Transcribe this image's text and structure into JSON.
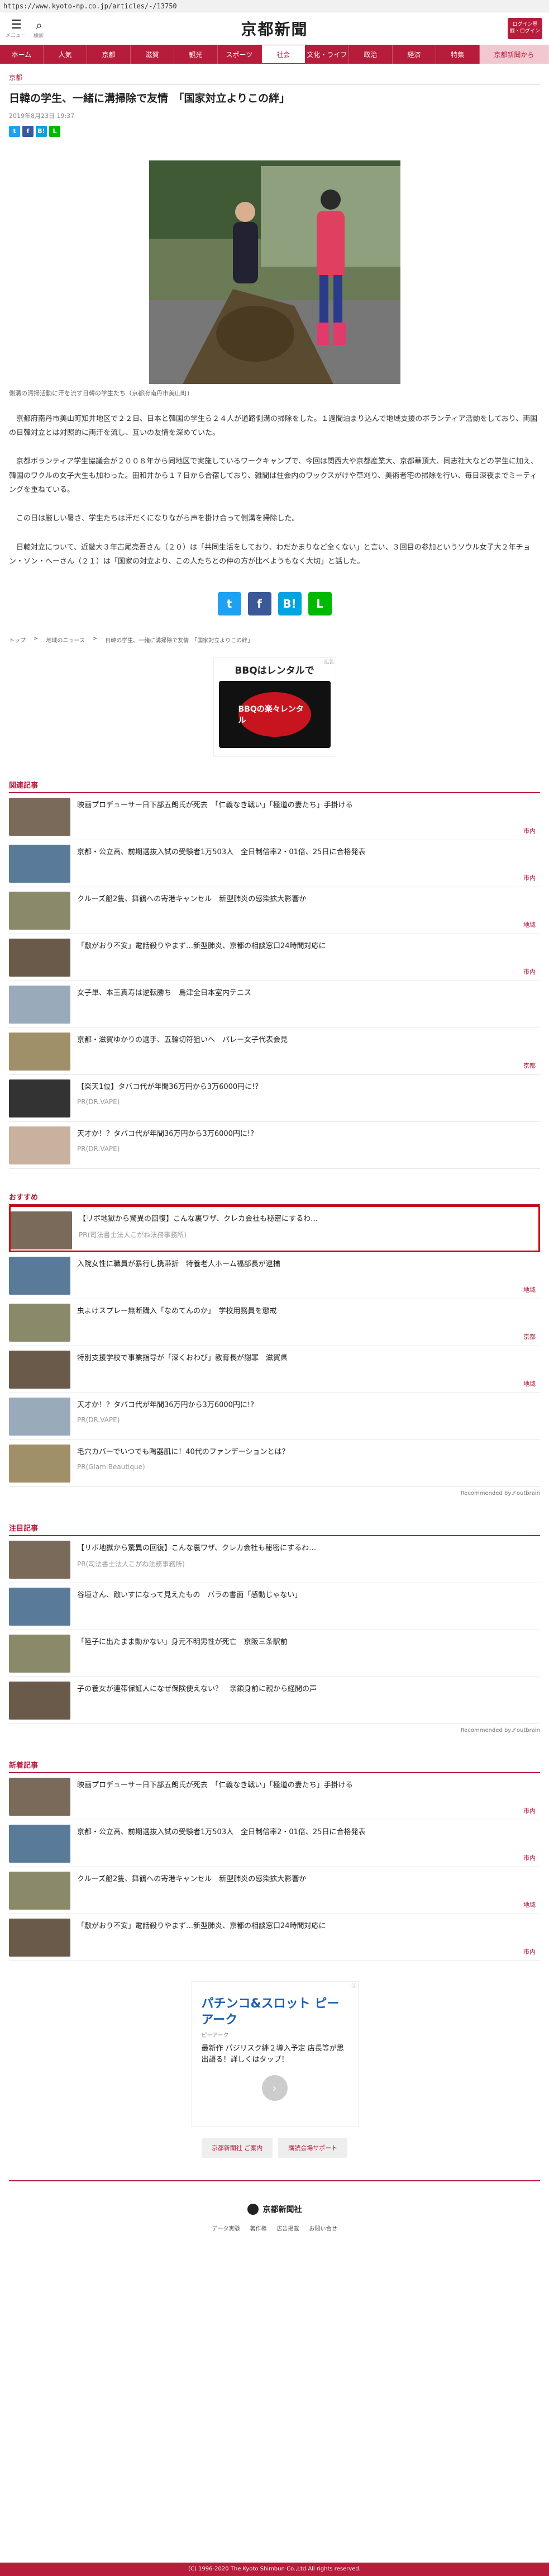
{
  "url": "https://www.kyoto-np.co.jp/articles/-/13750",
  "header": {
    "menu_label": "メニュー",
    "search_label": "検索",
    "logo": "京都新聞",
    "login": "ログイン登録・ログイン"
  },
  "nav": [
    "ホーム",
    "人気",
    "京都",
    "滋賀",
    "観光",
    "スポーツ",
    "社会",
    "文化・ライフ",
    "政治",
    "経済",
    "特集",
    "京都新聞から"
  ],
  "article": {
    "category": "京都",
    "title": "日韓の学生、一緒に溝掃除で友情　「国家対立よりこの絆」",
    "date": "2019年8月23日 19:37",
    "caption": "側溝の清掃活動に汗を流す日韓の学生たち（京都府南丹市美山町)",
    "paragraphs": [
      "　京都府南丹市美山町知井地区で２２日、日本と韓国の学生ら２４人が道路側溝の掃除をした。１週間泊まり込んで地域支援のボランティア活動をしており、両国の日韓対立とは対照的に両汗を流し、互いの友情を深めていた。",
      "　京都ボランティア学生協議会が２００８年から同地区で実施しているワークキャンプで、今回は関西大や京都産業大、京都華頂大、同志社大などの学生に加え、韓国のワクルの女子大生も加わった。田和井から１７日から合宿しており、雑間は住会内のワックスがけや草刈り、美術者宅の掃除を行い、毎日深夜までミーティングを重ねている。",
      "　この日は厳しい暑さ、学生たちは汗だくになりながら声を掛け合って側溝を掃除した。",
      "　日韓対立について、近畿大３年古尾亮吾さん（２０）は「共同生活をしており、わだかまりなど全くない」と言い、３回目の参加というソウル女子大２年チョン・ソン・ヘーさん（２１）は「国家の対立より、この人たちとの仲の方が比べようもなく大切」と話した。"
    ]
  },
  "share": {
    "twitter": "t",
    "facebook": "f",
    "hatena": "B!",
    "line": "L"
  },
  "breadcrumb": [
    "トップ",
    "地域のニュース",
    "日韓の学生、一緒に溝掃除で友情　「国家対立よりこの絆」"
  ],
  "ad1": {
    "label": "広告",
    "text": "BBQはレンタルで",
    "sub": "BBQの楽々レンタル"
  },
  "related": {
    "heading": "関連記事",
    "items": [
      {
        "title": "映画プロデューサー日下部五朗氏が死去　「仁義なき戦い」「極道の妻たち」手掛ける",
        "tag": "市内"
      },
      {
        "title": "京都・公立高、前期選抜入試の受験者1万503人　全日制倍率2・01倍、25日に合格発表",
        "tag": "市内"
      },
      {
        "title": "クルーズ船2隻、舞鶴への寄港キャンセル　新型肺炎の感染拡大影響か",
        "tag": "地域"
      },
      {
        "title": "「敷がおり不安」電話殺りやまず…新型肺炎、京都の相談窓口24時間対応に",
        "tag": "市内"
      },
      {
        "title": "女子単、本王真寿は逆転勝ち　島津全日本室内テニス",
        "tag": ""
      },
      {
        "title": "京都・滋賀ゆかりの選手、五輪切符狙いへ　パレー女子代表会見",
        "tag": "京都"
      },
      {
        "title": "【楽天1位】タバコ代が年間36万円から3万6000円に!?",
        "tag": "",
        "pr": "PR(DR.VAPE)"
      },
      {
        "title": "天才か！？タバコ代が年間36万円から3万6000円に!?",
        "tag": "",
        "pr": "PR(DR.VAPE)"
      }
    ]
  },
  "recommend": {
    "heading": "おすすめ",
    "items": [
      {
        "title": "【リボ地獄から驚異の回復】こんな裏ワザ、クレカ会社も秘密にするわ…",
        "tag": "",
        "pr": "PR(司法書士法人こがね法務事務所)"
      },
      {
        "title": "入院女性に職員が暴行し携帯折　特養老人ホーム福部長が逮捕",
        "tag": "地域"
      },
      {
        "title": "虫よけスプレー無断購入「なめてんのか」　学校用務員を懲戒",
        "tag": "京都"
      },
      {
        "title": "特別支援学校で事業指导が「深くおわび」教育長が謝罪　滋賀県",
        "tag": "地域"
      },
      {
        "title": "天才か！？タバコ代が年間36万円から3万6000円に!?",
        "tag": "",
        "pr": "PR(DR.VAPE)"
      },
      {
        "title": "毛穴カバーでいつでも陶器肌に！40代のファンデーションとは？",
        "tag": "",
        "pr": "PR(Glam Beautique)"
      }
    ],
    "by": "Recommended by ⁄⁄ outbrain"
  },
  "attention": {
    "heading": "注目記事",
    "items": [
      {
        "title": "【リボ地獄から驚異の回復】こんな裏ワザ、クレカ会社も秘密にするわ…",
        "pr": "PR(司法書士法人こがね法務事務所)"
      },
      {
        "title": "谷垣さん、敵いすになって見えたもの　バラの書面「感動じゃない」"
      },
      {
        "title": "「陸子に出たまま動かない」身元不明男性が死亡　京阪三条駅前"
      },
      {
        "title": "子の養女が連帯保証人になぜ保険使えない？　亲鎖身前に親から経閲の声"
      }
    ],
    "by": "Recommended by ⁄⁄ outbrain"
  },
  "latest": {
    "heading": "新着記事",
    "items": [
      {
        "title": "映画プロデューサー日下部五朗氏が死去　「仁義なき戦い」「極道の妻たち」手掛ける",
        "tag": "市内"
      },
      {
        "title": "京都・公立高、前期選抜入試の受験者1万503人　全日制倍率2・01倍、25日に合格発表",
        "tag": "市内"
      },
      {
        "title": "クルーズ船2隻、舞鶴への寄港キャンセル　新型肺炎の感染拡大影響か",
        "tag": "地域"
      },
      {
        "title": "「敷がおり不安」電話殺りやまず…新型肺炎、京都の相談窓口24時間対応に",
        "tag": "市内"
      }
    ]
  },
  "ad2": {
    "title": "パチンコ&スロット ピーアーク",
    "sub": "ピーアーク",
    "body": "最新作 パジリスク絆２導入予定 店長等が思出語る！詳しくはタップ！"
  },
  "footer": {
    "btn1": "京都新聞社 ご案内",
    "btn2": "購読会場サポート",
    "logo": "京都新聞社",
    "links": [
      "データ実験",
      "著作権",
      "広告掲載",
      "お問い合せ"
    ],
    "copyright": "(C) 1996-2020 The Kyoto Shimbun Co.,Ltd All rights reserved."
  }
}
